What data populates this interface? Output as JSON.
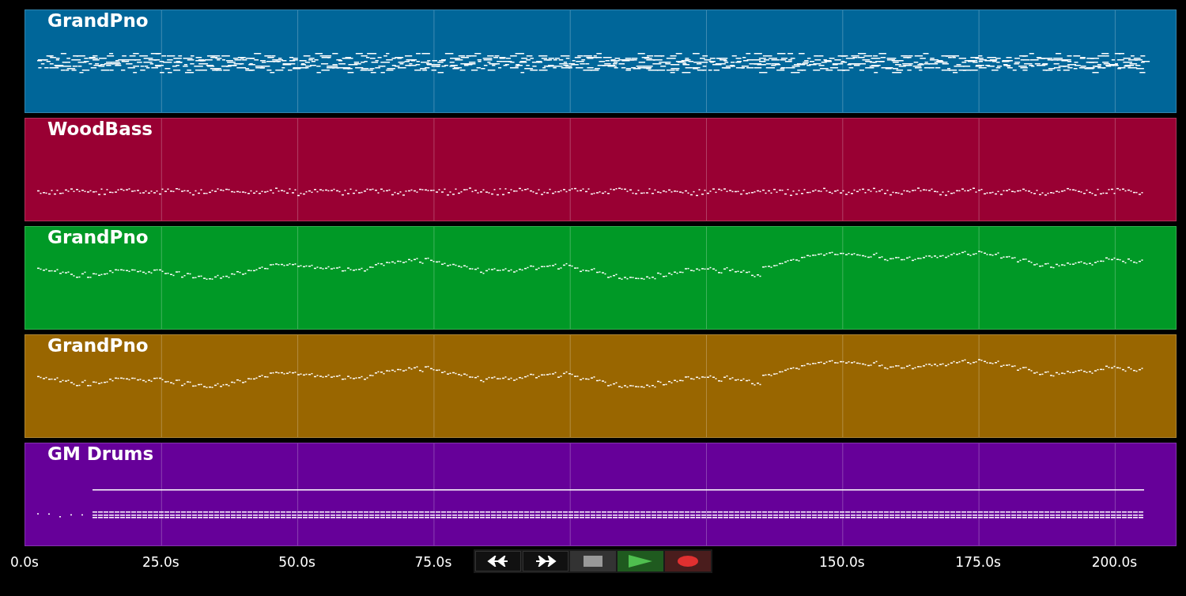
{
  "tracks": [
    {
      "name": "GrandPno",
      "color": "#006699",
      "kind": "chords"
    },
    {
      "name": "WoodBass",
      "color": "#990033",
      "kind": "bass"
    },
    {
      "name": "GrandPno",
      "color": "#009926",
      "kind": "melody"
    },
    {
      "name": "GrandPno",
      "color": "#996600",
      "kind": "melody"
    },
    {
      "name": "GM Drums",
      "color": "#660099",
      "kind": "drums"
    }
  ],
  "timeline": {
    "labels": [
      "0.0s",
      "25.0s",
      "50.0s",
      "75.0s",
      "150.0s",
      "175.0s",
      "200.0s"
    ]
  },
  "transport": [
    {
      "kind": "rewind"
    },
    {
      "kind": "forward"
    },
    {
      "kind": "stop"
    },
    {
      "kind": "play"
    },
    {
      "kind": "record"
    }
  ]
}
